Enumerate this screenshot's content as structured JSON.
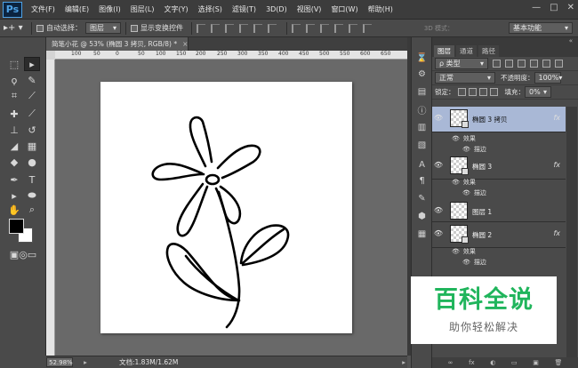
{
  "app": {
    "logo": "Ps"
  },
  "menu": [
    "文件(F)",
    "编辑(E)",
    "图像(I)",
    "图层(L)",
    "文字(Y)",
    "选择(S)",
    "滤镜(T)",
    "3D(D)",
    "视图(V)",
    "窗口(W)",
    "帮助(H)"
  ],
  "window_controls": [
    "—",
    "□",
    "✕"
  ],
  "options": {
    "auto_select_label": "自动选择：",
    "auto_select_value": "图层",
    "show_transform_label": "显示变换控件",
    "mode3d_label": "3D 模式：",
    "workspace": "基本功能"
  },
  "document": {
    "tab_title": "简笔小花 @ 53% (椭圆 3 拷贝, RGB/8) *",
    "close": "×",
    "ruler_ticks": [
      "100",
      "50",
      "0",
      "50",
      "100",
      "150",
      "200",
      "250",
      "300",
      "350",
      "400",
      "450",
      "500",
      "550",
      "600",
      "650"
    ]
  },
  "status": {
    "zoom": "52.98%",
    "doc_info": "文档:1.83M/1.62M",
    "arrow": "▸"
  },
  "layers_panel": {
    "tabs": [
      "图层",
      "通道",
      "路径"
    ],
    "filter_label": "ρ 类型",
    "blend_mode": "正常",
    "opacity_label": "不透明度：",
    "opacity_value": "100%",
    "lock_label": "锁定：",
    "fill_label": "填充：",
    "fill_value": "0%",
    "layers": [
      {
        "name": "椭圆 3 拷贝",
        "fx": "fx",
        "effects_label": "效果",
        "stroke_label": "描边",
        "selected": true
      },
      {
        "name": "椭圆 3",
        "fx": "fx",
        "effects_label": "效果",
        "stroke_label": "描边",
        "selected": false
      },
      {
        "name": "图层 1"
      },
      {
        "name": "椭圆 2",
        "fx": "fx",
        "effects_label": "效果",
        "stroke_label": "描边",
        "selected": false
      }
    ],
    "bottom_icons": [
      "∞",
      "fx",
      "◐",
      "▭",
      "▣",
      "🗑"
    ]
  },
  "watermark": {
    "title": "百科全说",
    "subtitle": "助你轻松解决"
  },
  "colors": {
    "accent_selected": "#a9b8d6",
    "watermark_green": "#20b55c"
  }
}
